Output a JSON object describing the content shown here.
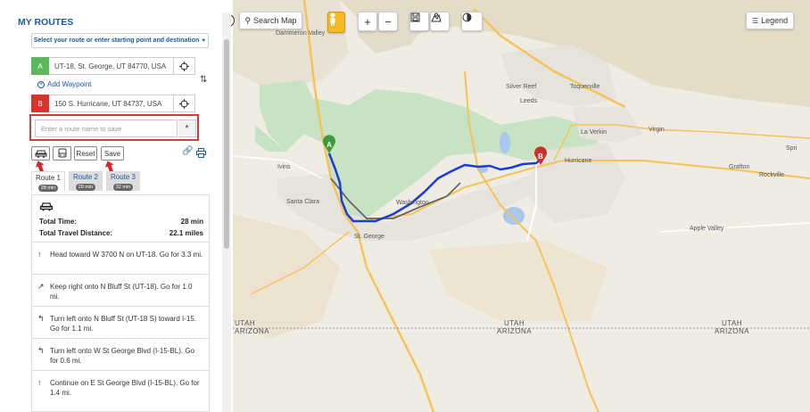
{
  "panel": {
    "title": "MY ROUTES",
    "select_label": "Select your route or enter starting point and destination",
    "point_a": {
      "marker": "A",
      "address": "UT-18, St. George, UT 84770, USA",
      "color": "#5cb85c"
    },
    "point_b": {
      "marker": "B",
      "address": "150 S. Hurricane, UT 84737, USA",
      "color": "#d9342b"
    },
    "add_waypoint": "Add Waypoint",
    "route_name_placeholder": "Enter a route name to save",
    "route_name_star": "*",
    "reset_label": "Reset",
    "save_label": "Save",
    "tabs": [
      {
        "label": "Route 1",
        "time": "28 min"
      },
      {
        "label": "Route 2",
        "time": "29 min"
      },
      {
        "label": "Route 3",
        "time": "32 min"
      }
    ],
    "summary": {
      "total_time_label": "Total Time:",
      "total_time_value": "28 min",
      "distance_label": "Total Travel Distance:",
      "distance_value": "22.1 miles"
    },
    "steps": [
      {
        "icon": "straight-arrow-icon",
        "text": "Head toward W 3700 N on UT-18. Go for 3.3 mi."
      },
      {
        "icon": "keep-right-icon",
        "text": "Keep right onto N Bluff St (UT-18). Go for 1.0 mi."
      },
      {
        "icon": "turn-left-icon",
        "text": "Turn left onto N Bluff St (UT-18 S) toward I-15. Go for 1.1 mi."
      },
      {
        "icon": "turn-left-icon",
        "text": "Turn left onto W St George Blvd (I-15-BL). Go for 0.6 mi."
      },
      {
        "icon": "straight-arrow-icon",
        "text": "Continue on E St George Blvd (I-15-BL). Go for 1.4 mi."
      }
    ]
  },
  "map": {
    "search_map": "Search Map",
    "legend": "Legend",
    "zoom_in": "+",
    "zoom_out": "−",
    "places": {
      "dammeron_valley": "Dammeron Valley",
      "silver_reef": "Silver Reef",
      "toquerville": "Toquerville",
      "leeds": "Leeds",
      "la_verkin": "La Verkin",
      "virgin": "Virgin",
      "ivins": "Ivins",
      "santa_clara": "Santa Clara",
      "washington": "Washington",
      "hurricane": "Hurricane",
      "grafton": "Grafton",
      "rockville": "Rockville",
      "spri": "Spri",
      "st_george": "St. George",
      "apple_valley": "Apple Valley"
    },
    "state_line": {
      "utah": "UTAH",
      "arizona": "ARIZONA"
    },
    "route_color": "#1a3ed1",
    "alt_route_color": "#666666"
  }
}
